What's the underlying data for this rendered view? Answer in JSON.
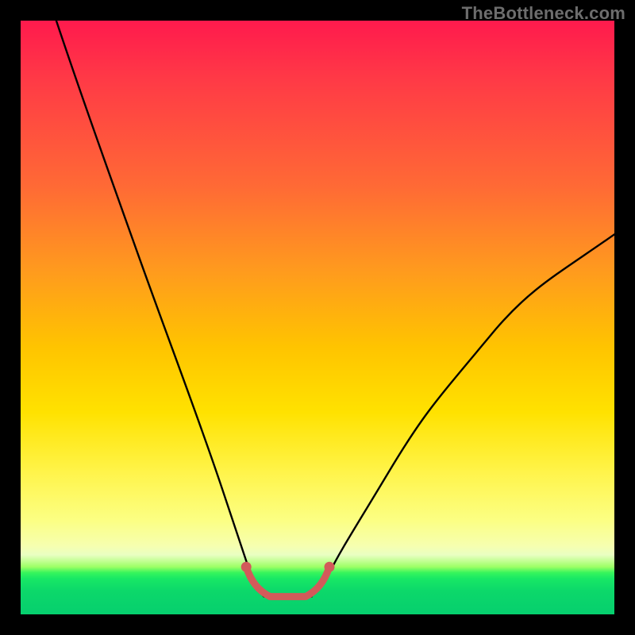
{
  "watermark": "TheBottleneck.com",
  "chart_data": {
    "type": "line",
    "title": "",
    "xlabel": "",
    "ylabel": "",
    "xlim": [
      0,
      100
    ],
    "ylim": [
      0,
      100
    ],
    "background_gradient": {
      "direction": "top-to-bottom",
      "stops": [
        {
          "pct": 0,
          "color": "#ff1a4d"
        },
        {
          "pct": 28,
          "color": "#ff6a35"
        },
        {
          "pct": 55,
          "color": "#ffc400"
        },
        {
          "pct": 76,
          "color": "#fff44a"
        },
        {
          "pct": 90,
          "color": "#e9ffc2"
        },
        {
          "pct": 94,
          "color": "#18e865"
        },
        {
          "pct": 100,
          "color": "#06cf6e"
        }
      ]
    },
    "series": [
      {
        "name": "bottleneck-curve",
        "stroke": "#000000",
        "points": [
          {
            "x": 6,
            "y": 100
          },
          {
            "x": 10,
            "y": 88
          },
          {
            "x": 15,
            "y": 74
          },
          {
            "x": 20,
            "y": 60
          },
          {
            "x": 25,
            "y": 46
          },
          {
            "x": 30,
            "y": 33
          },
          {
            "x": 34,
            "y": 21
          },
          {
            "x": 37,
            "y": 12
          },
          {
            "x": 39,
            "y": 6
          },
          {
            "x": 40,
            "y": 4
          },
          {
            "x": 41,
            "y": 3
          },
          {
            "x": 42,
            "y": 3
          },
          {
            "x": 45,
            "y": 3
          },
          {
            "x": 48,
            "y": 3
          },
          {
            "x": 49,
            "y": 3
          },
          {
            "x": 50,
            "y": 4
          },
          {
            "x": 52,
            "y": 7
          },
          {
            "x": 56,
            "y": 14
          },
          {
            "x": 62,
            "y": 24
          },
          {
            "x": 70,
            "y": 36
          },
          {
            "x": 80,
            "y": 48
          },
          {
            "x": 90,
            "y": 57
          },
          {
            "x": 100,
            "y": 64
          }
        ]
      },
      {
        "name": "optimal-flat-segment",
        "stroke": "#d25a5a",
        "stroke_width_px": 9,
        "points": [
          {
            "x": 38,
            "y": 8
          },
          {
            "x": 40,
            "y": 4
          },
          {
            "x": 42,
            "y": 3
          },
          {
            "x": 48,
            "y": 3
          },
          {
            "x": 50,
            "y": 4
          },
          {
            "x": 52,
            "y": 8
          }
        ],
        "end_markers": [
          {
            "x": 38,
            "y": 8
          },
          {
            "x": 52,
            "y": 8
          }
        ]
      }
    ]
  }
}
